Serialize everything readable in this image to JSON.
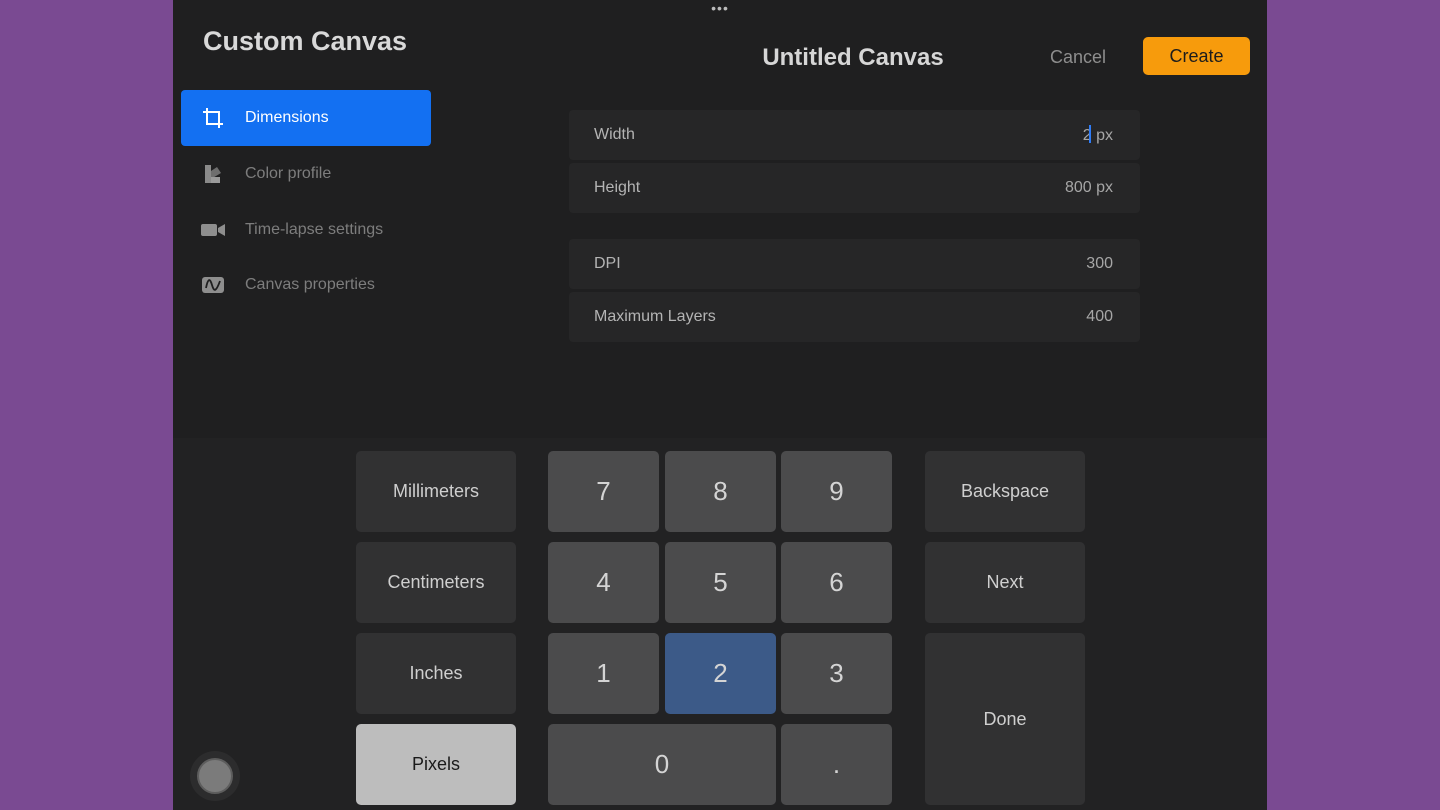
{
  "sidebar": {
    "title": "Custom Canvas",
    "items": [
      {
        "label": "Dimensions",
        "icon": "crop-icon",
        "active": true
      },
      {
        "label": "Color profile",
        "icon": "color-profile-icon",
        "active": false
      },
      {
        "label": "Time-lapse settings",
        "icon": "video-camera-icon",
        "active": false
      },
      {
        "label": "Canvas properties",
        "icon": "canvas-properties-icon",
        "active": false
      }
    ]
  },
  "header": {
    "title": "Untitled Canvas",
    "cancel_label": "Cancel",
    "create_label": "Create"
  },
  "fields": {
    "width": {
      "label": "Width",
      "value": "2",
      "unit": "px"
    },
    "height": {
      "label": "Height",
      "value": "800 px"
    },
    "dpi": {
      "label": "DPI",
      "value": "300"
    },
    "max_layers": {
      "label": "Maximum Layers",
      "value": "400"
    }
  },
  "keyboard": {
    "units": [
      "Millimeters",
      "Centimeters",
      "Inches",
      "Pixels"
    ],
    "selected_unit": "Pixels",
    "keys": {
      "k7": "7",
      "k8": "8",
      "k9": "9",
      "k4": "4",
      "k5": "5",
      "k6": "6",
      "k1": "1",
      "k2": "2",
      "k3": "3",
      "k0": "0",
      "kdot": "."
    },
    "pressed_key": "2",
    "actions": {
      "backspace": "Backspace",
      "next": "Next",
      "done": "Done"
    }
  },
  "colors": {
    "accent_blue": "#1370f2",
    "create_orange": "#f79b0c",
    "background_purple": "#7a4a92"
  }
}
